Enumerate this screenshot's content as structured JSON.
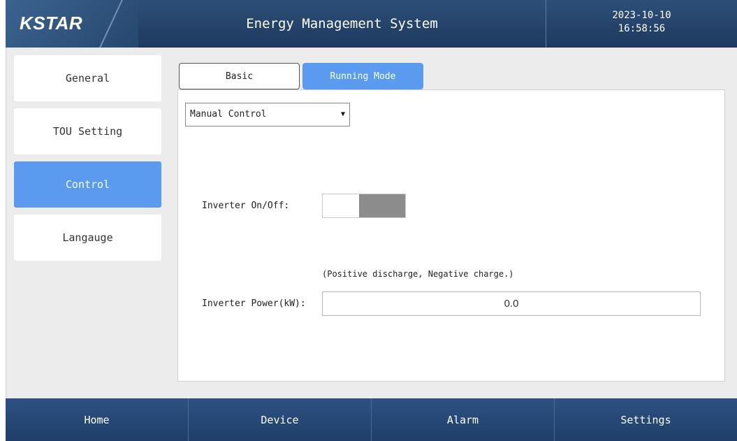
{
  "header": {
    "logo": "KSTAR",
    "title": "Energy Management System",
    "date": "2023-10-10",
    "time": "16:58:56"
  },
  "sidebar": {
    "items": [
      {
        "label": "General",
        "active": false
      },
      {
        "label": "TOU Setting",
        "active": false
      },
      {
        "label": "Control",
        "active": true
      },
      {
        "label": "Langauge",
        "active": false
      }
    ]
  },
  "tabs": {
    "basic": "Basic",
    "running_mode": "Running Mode",
    "active": "Running Mode"
  },
  "control": {
    "mode_select": "Manual Control",
    "inverter_onoff_label": "Inverter On/Off:",
    "inverter_onoff_state": "on",
    "power_hint": "(Positive discharge, Negative charge.)",
    "inverter_power_label": "Inverter Power(kW):",
    "inverter_power_value": "0.0"
  },
  "footer": {
    "home": "Home",
    "device": "Device",
    "alarm": "Alarm",
    "settings": "Settings"
  },
  "colors": {
    "header_bg": "#1e3a5f",
    "accent": "#5a9bf0",
    "toggle_on": "#8c8c8c"
  }
}
